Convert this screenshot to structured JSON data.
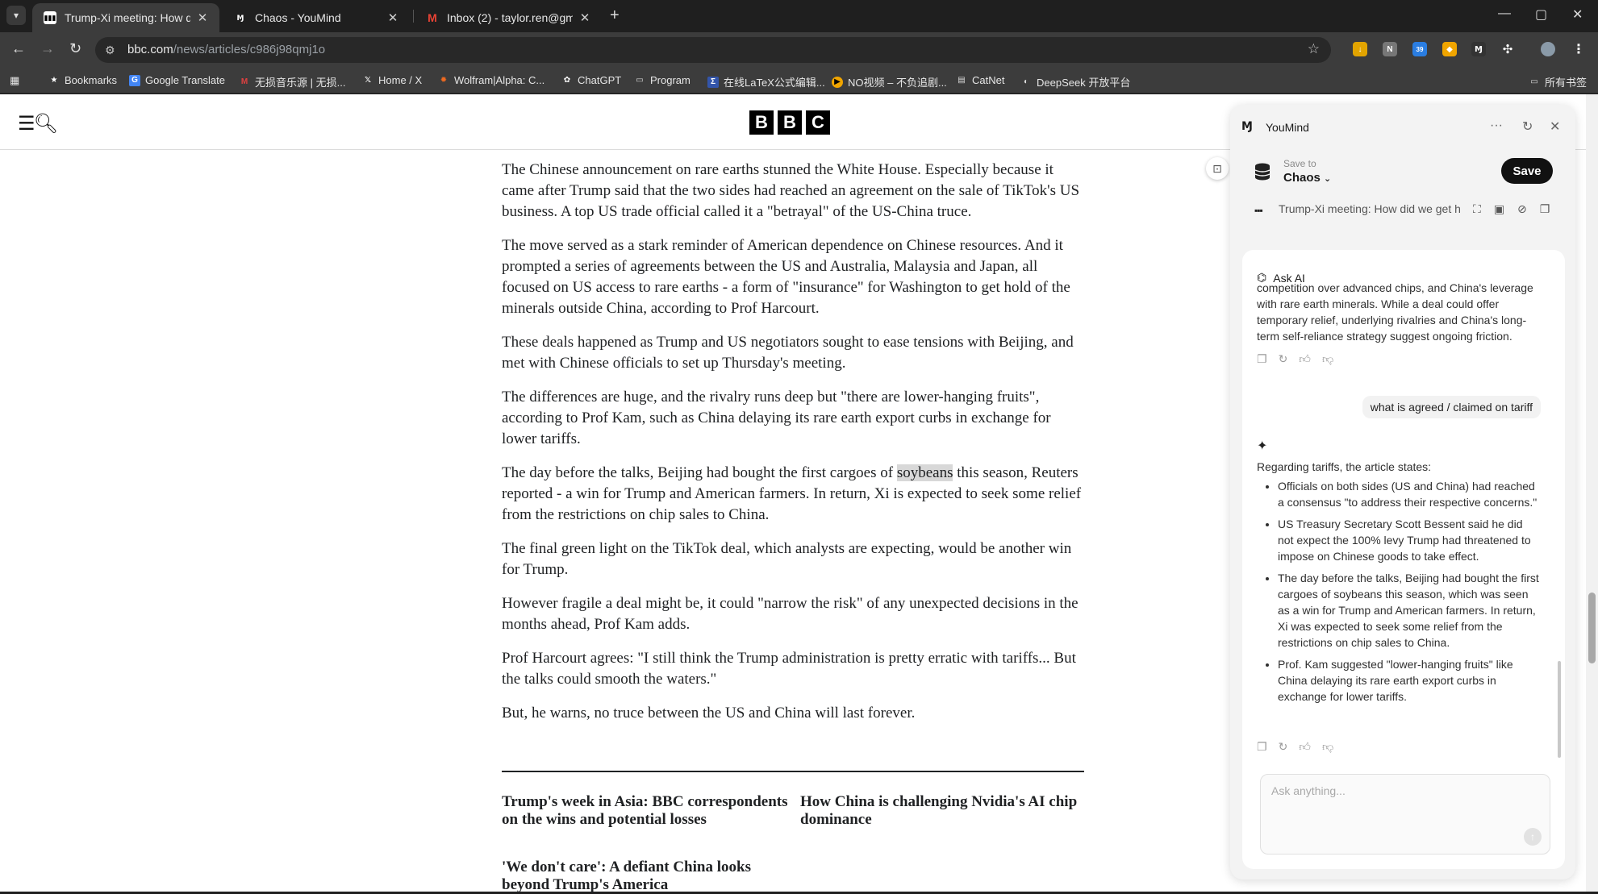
{
  "tabs": [
    {
      "title": "Trump-Xi meeting: How did",
      "active": true
    },
    {
      "title": "Chaos - YouMind",
      "active": false
    },
    {
      "title": "Inbox (2) - taylor.ren@gmail.",
      "active": false
    }
  ],
  "address": {
    "host": "bbc.com",
    "path": "/news/articles/c986j98qmj1o"
  },
  "extensions": {
    "badge_count": "39"
  },
  "bookmarks": [
    {
      "label": "Bookmarks",
      "icon": "star-icon"
    },
    {
      "label": "Google Translate",
      "icon": "translate-icon"
    },
    {
      "label": "无损音乐源 | 无损...",
      "icon": "music-icon"
    },
    {
      "label": "Home / X",
      "icon": "x-icon"
    },
    {
      "label": "Wolfram|Alpha: C...",
      "icon": "wolfram-icon"
    },
    {
      "label": "ChatGPT",
      "icon": "chatgpt-icon"
    },
    {
      "label": "Program",
      "icon": "folder-icon"
    },
    {
      "label": "在线LaTeX公式编辑...",
      "icon": "latex-icon"
    },
    {
      "label": "NO视频 – 不负追剧...",
      "icon": "video-icon"
    },
    {
      "label": "CatNet",
      "icon": "catnet-icon"
    },
    {
      "label": "DeepSeek 开放平台",
      "icon": "deepseek-icon"
    },
    {
      "label": "所有书签",
      "icon": "folder-icon"
    }
  ],
  "bbc": {
    "logo": [
      "B",
      "B",
      "C"
    ]
  },
  "article": {
    "p1": "The Chinese announcement on rare earths stunned the White House. Especially because it came after Trump said that the two sides had reached an agreement on the sale of TikTok's US business. A top US trade official called it a \"betrayal\" of the US-China truce.",
    "p2": "The move served as a stark reminder of American dependence on Chinese resources. And it prompted a series of agreements between the US and Australia, Malaysia and Japan, all focused on US access to rare earths - a form of \"insurance\" for Washington to get hold of the minerals outside China, according to Prof Harcourt.",
    "p3": "These deals happened as Trump and US negotiators sought to ease tensions with Beijing, and met with Chinese officials to set up Thursday's meeting.",
    "p4": "The differences are huge, and the rivalry runs deep but \"there are lower-hanging fruits\", according to Prof Kam, such as China delaying its rare earth export curbs in exchange for lower tariffs.",
    "p5_before": "The day before the talks, Beijing had bought the first cargoes of ",
    "p5_highlight": "soybeans",
    "p5_after": " this season, Reuters reported - a win for Trump and American farmers. In return, Xi is expected to seek some relief from the restrictions on chip sales to China.",
    "p6": "The final green light on the TikTok deal, which analysts are expecting, would be another win for Trump.",
    "p7": "However fragile a deal might be, it could \"narrow the risk\" of any unexpected decisions in the months ahead, Prof Kam adds.",
    "p8": "Prof Harcourt agrees: \"I still think the Trump administration is pretty erratic with tariffs... But the talks could smooth the waters.\"",
    "p9": "But, he warns, no truce between the US and China will last forever."
  },
  "related": [
    "Trump's week in Asia: BBC correspondents on the wins and potential losses",
    "How China is challenging Nvidia's AI chip dominance",
    "'We don't care': A defiant China looks beyond Trump's America"
  ],
  "youmind": {
    "title": "YouMind",
    "save_to_label": "Save to",
    "save_to_value": "Chaos",
    "save_button": "Save",
    "source_title": "Trump-Xi meeting: How did we get h",
    "ask_ai": "Ask AI",
    "prev_answer": "competition over advanced chips, and China's leverage with rare earth minerals. While a deal could offer temporary relief, underlying rivalries and China's long-term self-reliance strategy suggest ongoing friction.",
    "user_question": "what is agreed / claimed on tariff",
    "answer_intro": "Regarding tariffs, the article states:",
    "answer_points": [
      "Officials on both sides (US and China) had reached a consensus \"to address their respective concerns.\"",
      "US Treasury Secretary Scott Bessent said he did not expect the 100% levy Trump had threatened to impose on Chinese goods to take effect.",
      "The day before the talks, Beijing had bought the first cargoes of soybeans this season, which was seen as a win for Trump and American farmers. In return, Xi was expected to seek some relief from the restrictions on chip sales to China.",
      "Prof. Kam suggested \"lower-hanging fruits\" like China delaying its rare earth export curbs in exchange for lower tariffs."
    ],
    "input_placeholder": "Ask anything..."
  },
  "colors": {
    "accent": "#111111",
    "page_bg": "#ffffff",
    "chrome_bg": "#3c3c3c",
    "highlight": "#d8d8d8"
  }
}
